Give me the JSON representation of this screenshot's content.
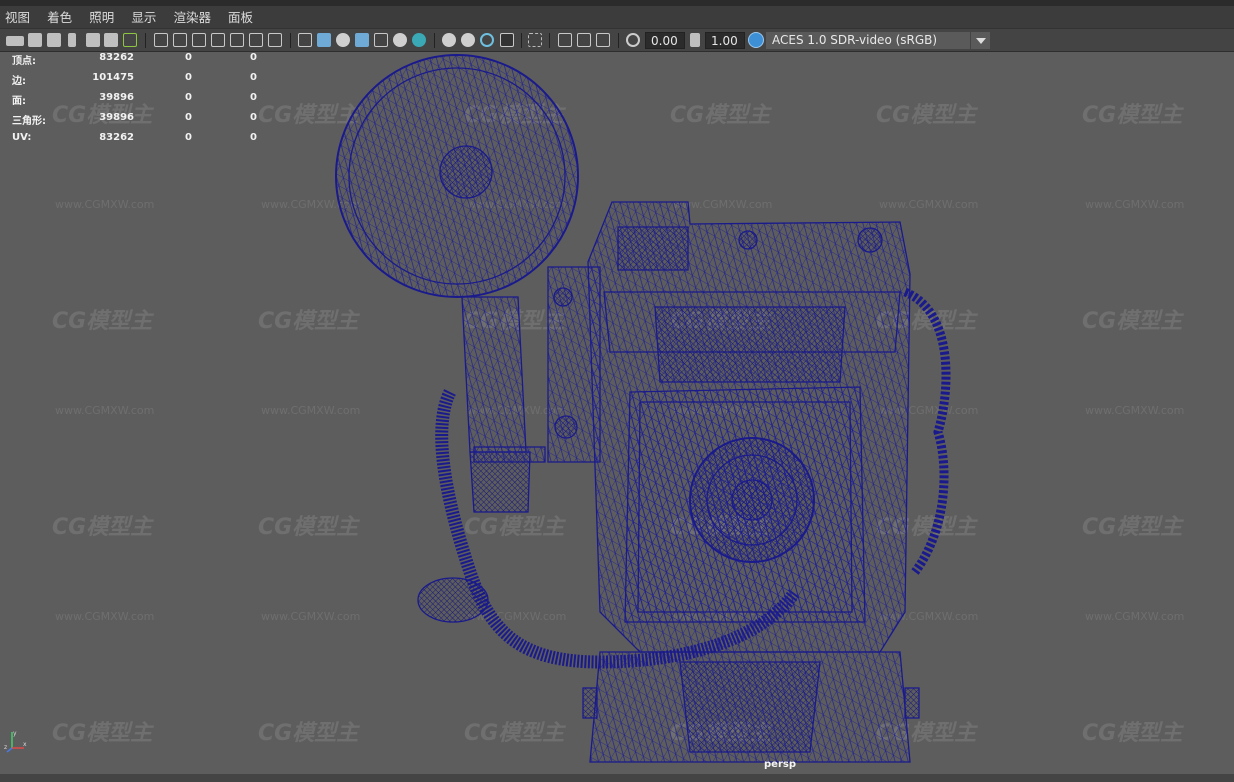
{
  "menu": {
    "items": [
      {
        "label": "视图"
      },
      {
        "label": "着色"
      },
      {
        "label": "照明"
      },
      {
        "label": "显示"
      },
      {
        "label": "渲染器"
      },
      {
        "label": "面板"
      }
    ]
  },
  "toolbar": {
    "exposure_value": "0.00",
    "gamma_value": "1.00",
    "color_space": "ACES 1.0 SDR-video (sRGB)"
  },
  "hud": {
    "rows": [
      {
        "label": "顶点:",
        "v1": "83262",
        "v2": "0",
        "v3": "0"
      },
      {
        "label": "边:",
        "v1": "101475",
        "v2": "0",
        "v3": "0"
      },
      {
        "label": "面:",
        "v1": "39896",
        "v2": "0",
        "v3": "0"
      },
      {
        "label": "三角形:",
        "v1": "39896",
        "v2": "0",
        "v3": "0"
      },
      {
        "label": "UV:",
        "v1": "83262",
        "v2": "0",
        "v3": "0"
      }
    ]
  },
  "viewport": {
    "camera_name": "persp",
    "background_color": "#5d5d5d",
    "wireframe_color": "#1a1a8c",
    "axis": {
      "x_label": "x",
      "y_label": "y",
      "z_label": "z"
    }
  },
  "watermark": {
    "logo_text": "CG模型主",
    "url_text": "www.CGMXW.com"
  }
}
